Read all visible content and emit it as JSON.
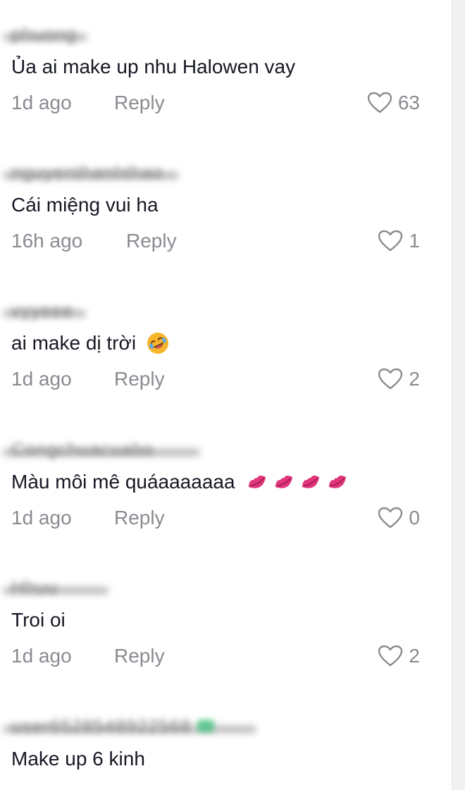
{
  "comments": [
    {
      "username": "phuong",
      "text": "Ủa ai make up nhu Halowen vay",
      "time": "1d ago",
      "reply_label": "Reply",
      "likes": "63",
      "emoji": []
    },
    {
      "username": "nguyenthanhthao",
      "text": "Cái miệng vui ha",
      "time": "16h ago",
      "reply_label": "Reply",
      "likes": "1",
      "emoji": []
    },
    {
      "username": "vyyeee",
      "text": "ai make dị trời",
      "time": "1d ago",
      "reply_label": "Reply",
      "likes": "2",
      "emoji": [
        "rolling-on-floor-laughing-emoji"
      ]
    },
    {
      "username": "Congchuacuabo",
      "text": "Màu môi mê quáaaaaaaa",
      "time": "1d ago",
      "reply_label": "Reply",
      "likes": "0",
      "emoji": [
        "kiss-mark-emoji",
        "kiss-mark-emoji",
        "kiss-mark-emoji",
        "kiss-mark-emoji"
      ]
    },
    {
      "username": "Hhuu",
      "text": "Troi oi",
      "time": "1d ago",
      "reply_label": "Reply",
      "likes": "2",
      "emoji": []
    },
    {
      "username": "user6528548922568",
      "text": "Make up 6 kinh",
      "time": "",
      "reply_label": "",
      "likes": "",
      "emoji": []
    }
  ],
  "colors": {
    "text_primary": "#161823",
    "text_secondary": "#8a8b91",
    "heart_outline": "#8a8b91",
    "lips": "#e0357a",
    "emoji_face": "#f7b52c",
    "verified_badge": "#3cc27a"
  }
}
